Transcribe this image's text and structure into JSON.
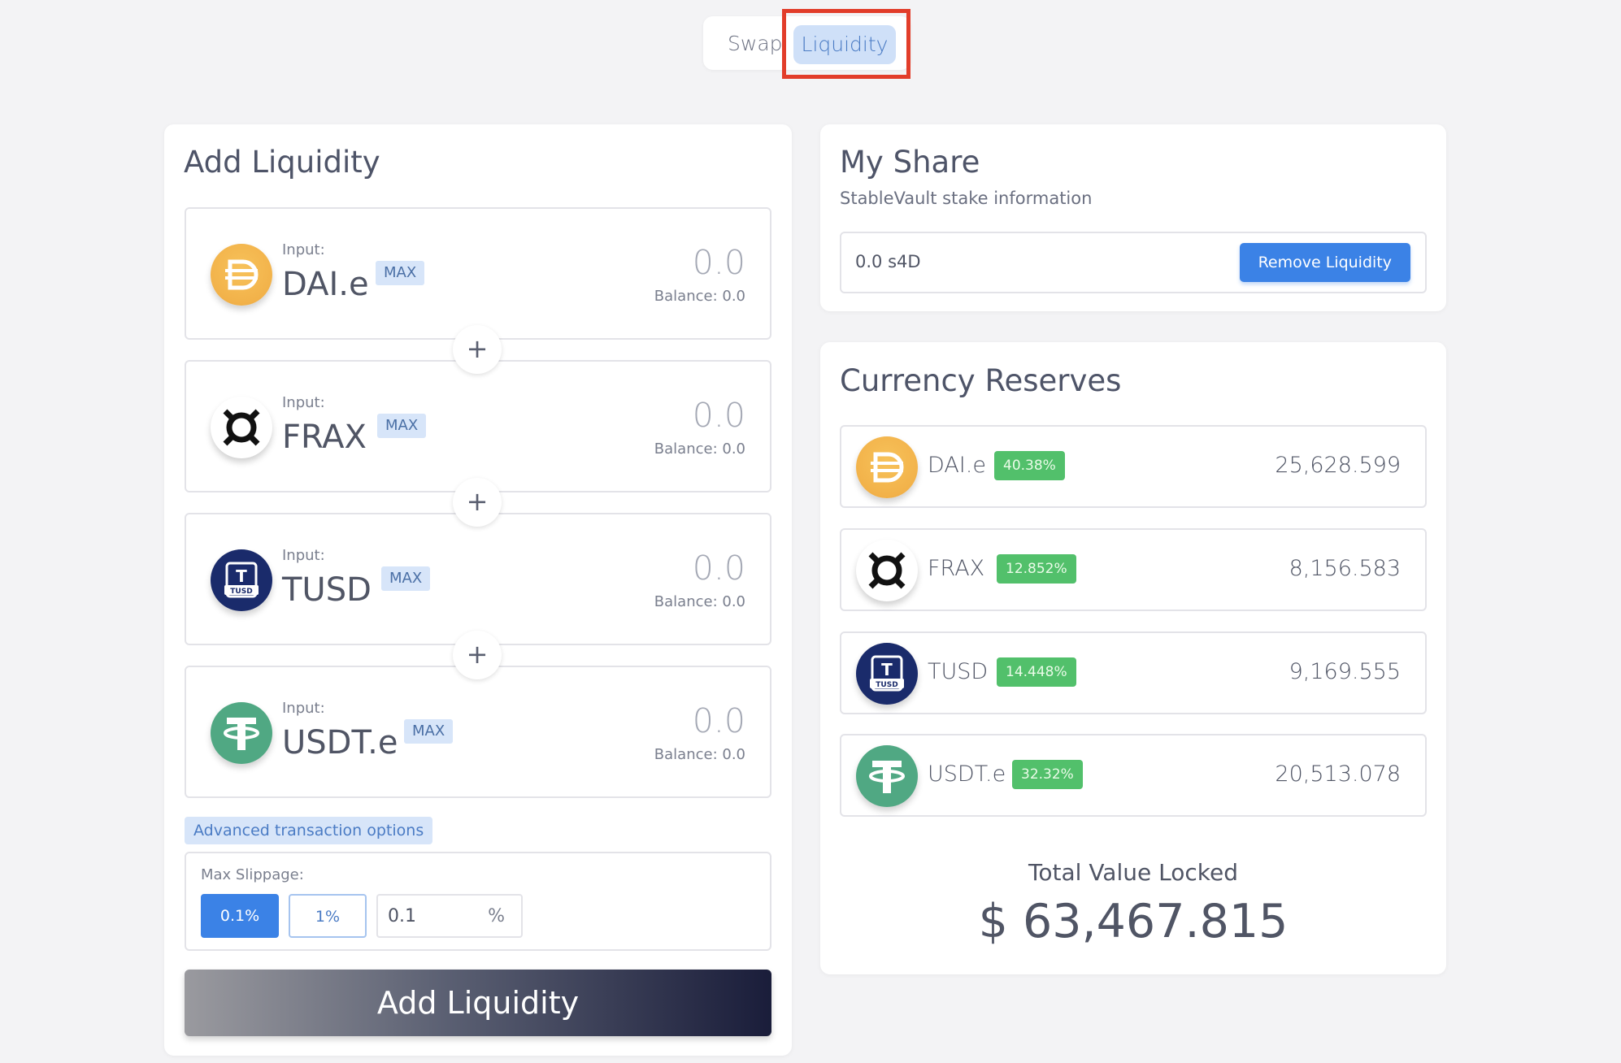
{
  "tabs": {
    "swap": "Swap",
    "liquidity": "Liquidity"
  },
  "add_liquidity": {
    "title": "Add Liquidity",
    "inputs": [
      {
        "label": "Input:",
        "token": "DAI.e",
        "max": "MAX",
        "amount": "0.0",
        "balance": "Balance: 0.0",
        "icon": "dai-icon"
      },
      {
        "label": "Input:",
        "token": "FRAX",
        "max": "MAX",
        "amount": "0.0",
        "balance": "Balance: 0.0",
        "icon": "frax-icon"
      },
      {
        "label": "Input:",
        "token": "TUSD",
        "max": "MAX",
        "amount": "0.0",
        "balance": "Balance: 0.0",
        "icon": "tusd-icon"
      },
      {
        "label": "Input:",
        "token": "USDT.e",
        "max": "MAX",
        "amount": "0.0",
        "balance": "Balance: 0.0",
        "icon": "usdt-icon"
      }
    ],
    "plus": "+",
    "advanced": "Advanced transaction options",
    "slippage": {
      "label": "Max Slippage:",
      "options": [
        "0.1%",
        "1%"
      ],
      "custom_value": "0.1",
      "custom_unit": "%"
    },
    "submit": "Add Liquidity"
  },
  "my_share": {
    "title": "My Share",
    "subtitle": "StableVault stake information",
    "value": "0.0 s4D",
    "remove": "Remove Liquidity"
  },
  "reserves": {
    "title": "Currency Reserves",
    "rows": [
      {
        "token": "DAI.e",
        "pct": "40.38%",
        "amount": "25,628.599",
        "icon": "dai-icon"
      },
      {
        "token": "FRAX",
        "pct": "12.852%",
        "amount": "8,156.583",
        "icon": "frax-icon"
      },
      {
        "token": "TUSD",
        "pct": "14.448%",
        "amount": "9,169.555",
        "icon": "tusd-icon"
      },
      {
        "token": "USDT.e",
        "pct": "32.32%",
        "amount": "20,513.078",
        "icon": "usdt-icon"
      }
    ],
    "tvl_label": "Total Value Locked",
    "tvl_value": "$ 63,467.815"
  },
  "tusd_icon_text": {
    "letter": "T",
    "caption": "TUSD"
  },
  "colors": {
    "accent": "#3b82e6",
    "tab_active_bg": "#cfe0f8",
    "highlight_box": "#e23d2a",
    "badge_green": "#52c06b",
    "dai": "#f2b24a",
    "tusd": "#1a2b6b",
    "usdt": "#50a883"
  }
}
